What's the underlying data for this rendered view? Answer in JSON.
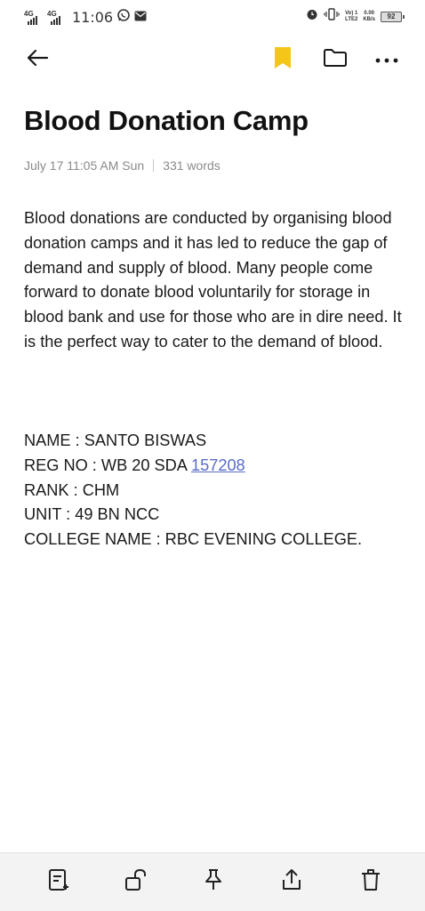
{
  "status_bar": {
    "net1": "4G",
    "net2": "4G",
    "time": "11:06",
    "volte_top": "Vo) 1",
    "volte_bottom": "LTE2",
    "speed_value": "0.00",
    "speed_unit": "KB/s",
    "battery": "92"
  },
  "note": {
    "title": "Blood Donation Camp",
    "date": "July 17 11:05 AM Sun",
    "word_count": "331 words",
    "paragraph": "Blood donations are conducted by organising blood donation camps and it has led to reduce the gap of demand and supply of blood. Many people come forward to donate blood voluntarily for storage in blood bank and use for those who are in dire need. It is the perfect way to cater to the demand of blood.",
    "name_line": "NAME : SANTO BISWAS",
    "reg_prefix": "REG NO : WB 20 SDA ",
    "reg_link": "157208",
    "rank_line": "RANK : CHM",
    "unit_line": "UNIT : 49 BN NCC",
    "college_line": "COLLEGE NAME : RBC EVENING COLLEGE."
  },
  "colors": {
    "bookmark": "#f5c518",
    "link": "#5a6cc8",
    "meta": "#8a8a8a"
  },
  "toolbar_icons": [
    "back-arrow-icon",
    "bookmark-icon",
    "folder-icon",
    "more-icon"
  ],
  "bottom_icons": [
    "edit-note-icon",
    "unlock-icon",
    "pin-icon",
    "share-icon",
    "delete-icon"
  ]
}
